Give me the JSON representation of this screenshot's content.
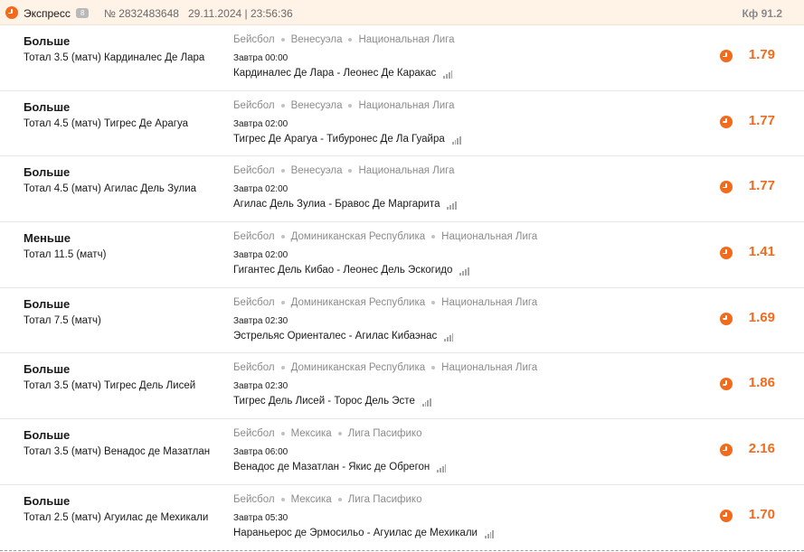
{
  "header": {
    "title": "Экспресс",
    "count": "8",
    "number": "№ 2832483648",
    "datetime": "29.11.2024 | 23:56:36",
    "kf_label": "Кф",
    "kf_value": "91.2"
  },
  "bets": [
    {
      "type": "Больше",
      "name": "Тотал 3.5 (матч) Кардиналес Де Лара",
      "sport": "Бейсбол",
      "country": "Венесуэла",
      "league": "Национальная Лига",
      "time": "Завтра 00:00",
      "match": "Кардиналес Де Лара - Леонес Де Каракас",
      "odd": "1.79"
    },
    {
      "type": "Больше",
      "name": "Тотал 4.5 (матч) Тигрес Де Арагуа",
      "sport": "Бейсбол",
      "country": "Венесуэла",
      "league": "Национальная Лига",
      "time": "Завтра 02:00",
      "match": "Тигрес Де Арагуа - Тибуронес Де Ла Гуайра",
      "odd": "1.77"
    },
    {
      "type": "Больше",
      "name": "Тотал 4.5 (матч) Агилас Дель Зулиа",
      "sport": "Бейсбол",
      "country": "Венесуэла",
      "league": "Национальная Лига",
      "time": "Завтра 02:00",
      "match": "Агилас Дель Зулиа - Бравос Де Маргарита",
      "odd": "1.77"
    },
    {
      "type": "Меньше",
      "name": "Тотал 11.5 (матч)",
      "sport": "Бейсбол",
      "country": "Доминиканская Республика",
      "league": "Национальная Лига",
      "time": "Завтра 02:00",
      "match": "Гигантес Дель Кибао - Леонес Дель Эскогидо",
      "odd": "1.41"
    },
    {
      "type": "Больше",
      "name": "Тотал 7.5 (матч)",
      "sport": "Бейсбол",
      "country": "Доминиканская Республика",
      "league": "Национальная Лига",
      "time": "Завтра 02:30",
      "match": "Эстрельяс Ориенталес - Агилас Кибаэнас",
      "odd": "1.69"
    },
    {
      "type": "Больше",
      "name": "Тотал 3.5 (матч) Тигрес Дель Лисей",
      "sport": "Бейсбол",
      "country": "Доминиканская Республика",
      "league": "Национальная Лига",
      "time": "Завтра 02:30",
      "match": "Тигрес Дель Лисей - Торос Дель Эсте",
      "odd": "1.86"
    },
    {
      "type": "Больше",
      "name": "Тотал 3.5 (матч) Венадос де Мазатлан",
      "sport": "Бейсбол",
      "country": "Мексика",
      "league": "Лига Пасифико",
      "time": "Завтра 06:00",
      "match": "Венадос де Мазатлан - Якис де Обрегон",
      "odd": "2.16"
    },
    {
      "type": "Больше",
      "name": "Тотал 2.5 (матч) Агуилас де Мехикали",
      "sport": "Бейсбол",
      "country": "Мексика",
      "league": "Лига Пасифико",
      "time": "Завтра 05:30",
      "match": "Нараньерос де Эрмосильо - Агуилас де Мехикали",
      "odd": "1.70"
    }
  ]
}
